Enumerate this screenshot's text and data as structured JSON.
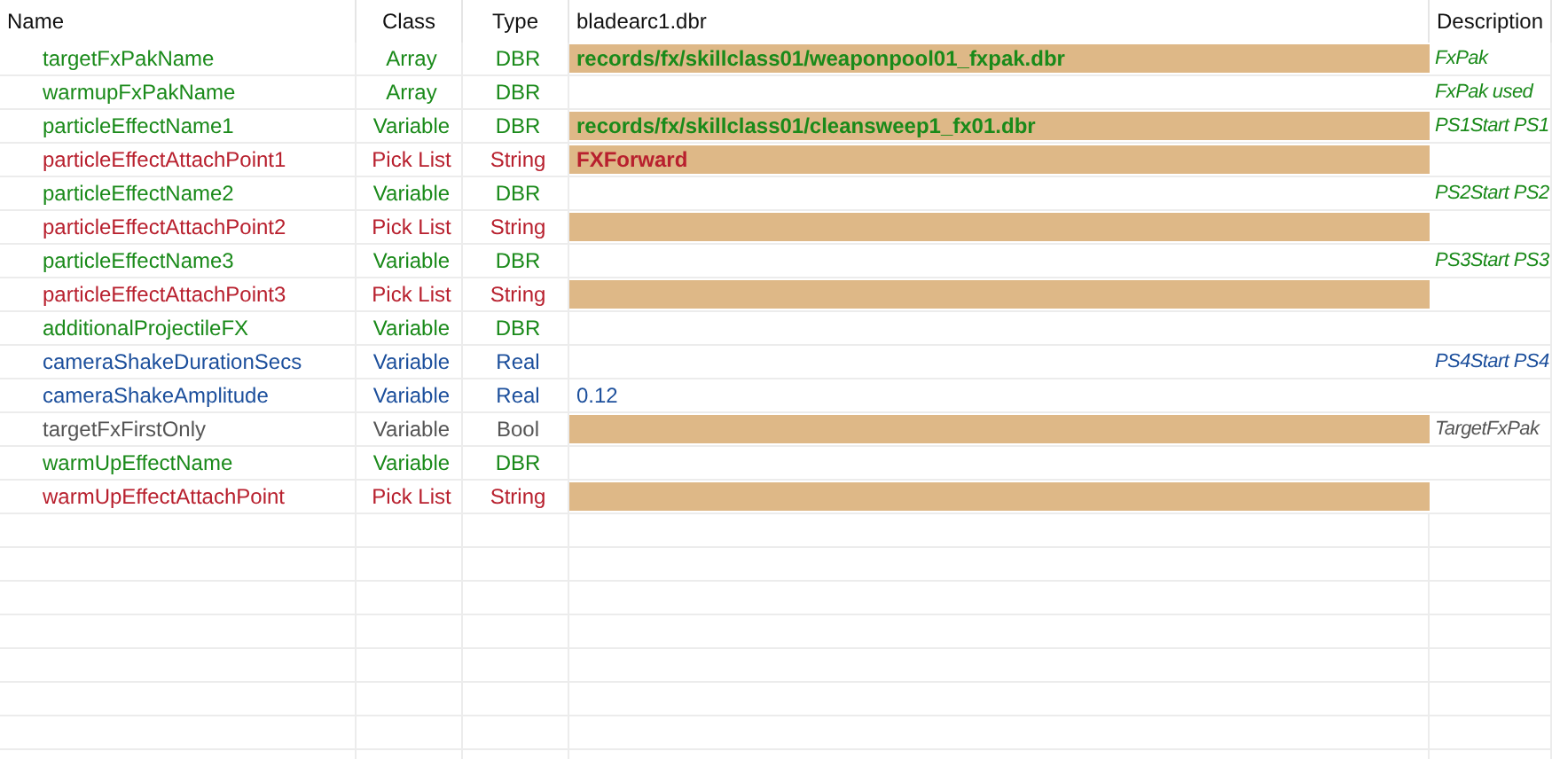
{
  "columns": [
    "Name",
    "Class",
    "Type",
    "bladearc1.dbr",
    "Description"
  ],
  "rows": [
    {
      "name": "targetFxPakName",
      "class": "Array",
      "type": "DBR",
      "value": "records/fx/skillclass01/weaponpool01_fxpak.dbr",
      "highlighted": true,
      "description": "FxPak",
      "color": "#1a8a1a"
    },
    {
      "name": "warmupFxPakName",
      "class": "Array",
      "type": "DBR",
      "highlighted": false,
      "description": "FxPak used",
      "color": "#1a8a1a"
    },
    {
      "name": "particleEffectName1",
      "class": "Variable",
      "type": "DBR",
      "value": "records/fx/skillclass01/cleansweep1_fx01.dbr",
      "highlighted": true,
      "description": "PS1Start PS1",
      "color": "#1a8a1a"
    },
    {
      "name": "particleEffectAttachPoint1",
      "class": "Pick List",
      "type": "String",
      "value": "FXForward",
      "highlighted": true,
      "color": "#b8202e"
    },
    {
      "name": "particleEffectName2",
      "class": "Variable",
      "type": "DBR",
      "highlighted": false,
      "description": "PS2Start PS2",
      "color": "#1a8a1a"
    },
    {
      "name": "particleEffectAttachPoint2",
      "class": "Pick List",
      "type": "String",
      "highlighted": true,
      "color": "#b8202e"
    },
    {
      "name": "particleEffectName3",
      "class": "Variable",
      "type": "DBR",
      "highlighted": false,
      "description": "PS3Start PS3",
      "color": "#1a8a1a"
    },
    {
      "name": "particleEffectAttachPoint3",
      "class": "Pick List",
      "type": "String",
      "highlighted": true,
      "color": "#b8202e"
    },
    {
      "name": "additionalProjectileFX",
      "class": "Variable",
      "type": "DBR",
      "highlighted": false,
      "color": "#1a8a1a"
    },
    {
      "name": "cameraShakeDurationSecs",
      "class": "Variable",
      "type": "Real",
      "highlighted": false,
      "description": "PS4Start PS4",
      "color": "#1c4f9c"
    },
    {
      "name": "cameraShakeAmplitude",
      "class": "Variable",
      "type": "Real",
      "value": "0.12",
      "highlighted": false,
      "color": "#1c4f9c"
    },
    {
      "name": "targetFxFirstOnly",
      "class": "Variable",
      "type": "Bool",
      "highlighted": true,
      "description": "TargetFxPak",
      "color": "#555555"
    },
    {
      "name": "warmUpEffectName",
      "class": "Variable",
      "type": "DBR",
      "highlighted": false,
      "color": "#1a8a1a"
    },
    {
      "name": "warmUpEffectAttachPoint",
      "class": "Pick List",
      "type": "String",
      "highlighted": true,
      "color": "#b8202e"
    }
  ]
}
